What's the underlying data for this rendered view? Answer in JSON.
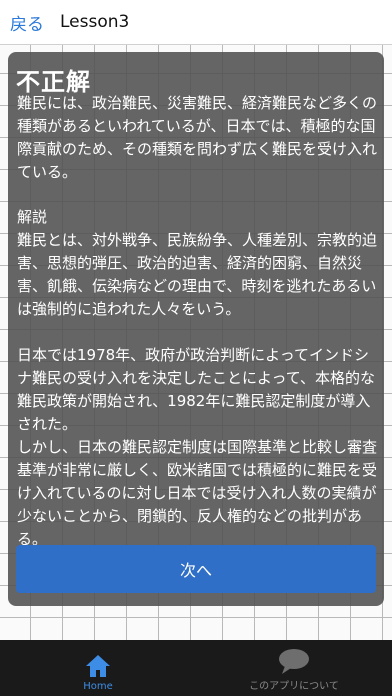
{
  "header": {
    "back_label": "戻る",
    "title": "Lesson3"
  },
  "result": {
    "title": "不正解",
    "question_text": "難民には、政治難民、災害難民、経済難民など多くの種類があるといわれているが、日本では、積極的な国際貢献のため、その種類を問わず広く難民を受け入れている。",
    "explanation_heading": "解説",
    "explanation_p1": "難民とは、対外戦争、民族紛争、人種差別、宗教的迫害、思想的弾圧、政治的迫害、経済的困窮、自然災害、飢餓、伝染病などの理由で、時刻を逃れたあるいは強制的に追われた人々をいう。",
    "explanation_p2": "日本では1978年、政府が政治判断によってインドシナ難民の受け入れを決定したことによって、本格的な難民政策が開始され、1982年に難民認定制度が導入された。",
    "explanation_p3": "しかし、日本の難民認定制度は国際基準と比較し審査基準が非常に厳しく、欧米諸国では積極的に難民を受け入れているのに対し日本では受け入れ人数の実績が少ないことから、閉鎖的、反人権的などの批判がある。",
    "next_label": "次へ"
  },
  "tabbar": {
    "home_label": "Home",
    "about_label": "このアプリについて",
    "home_icon": "home-icon",
    "about_icon": "speech-bubble-icon"
  },
  "colors": {
    "accent": "#2a78d8",
    "button": "#2f6fc7",
    "overlay": "#505050",
    "tabbar": "#1a1a1a"
  }
}
